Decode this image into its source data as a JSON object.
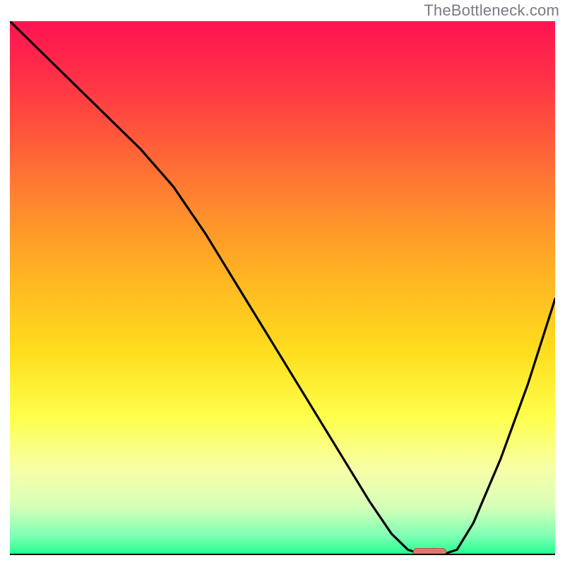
{
  "watermark": "TheBottleneck.com",
  "colors": {
    "gradient_stops": [
      {
        "offset": 0.0,
        "color": "#ff1353"
      },
      {
        "offset": 0.1,
        "color": "#ff2f47"
      },
      {
        "offset": 0.22,
        "color": "#ff5a3a"
      },
      {
        "offset": 0.35,
        "color": "#ff8a2e"
      },
      {
        "offset": 0.48,
        "color": "#ffb522"
      },
      {
        "offset": 0.62,
        "color": "#ffde1e"
      },
      {
        "offset": 0.74,
        "color": "#feff4a"
      },
      {
        "offset": 0.84,
        "color": "#f7ffa8"
      },
      {
        "offset": 0.91,
        "color": "#d6ffb8"
      },
      {
        "offset": 0.965,
        "color": "#7cffb4"
      },
      {
        "offset": 1.0,
        "color": "#1dff8c"
      }
    ],
    "curve": "#000000",
    "marker_fill": "#e0776f",
    "marker_stroke": "#b7554f"
  },
  "chart_data": {
    "type": "line",
    "title": "",
    "xlabel": "",
    "ylabel": "",
    "xlim": [
      0,
      100
    ],
    "ylim": [
      0,
      100
    ],
    "series": [
      {
        "name": "bottleneck-curve",
        "x": [
          0,
          6,
          12,
          18,
          24,
          30,
          36,
          42,
          48,
          54,
          60,
          66,
          70,
          73,
          76,
          79,
          82,
          85,
          90,
          95,
          100
        ],
        "y": [
          100,
          94,
          88,
          82,
          76,
          69,
          60,
          50,
          40,
          30,
          20,
          10,
          4,
          1,
          0,
          0,
          1,
          6,
          18,
          32,
          48
        ]
      }
    ],
    "marker": {
      "name": "optimal-range",
      "x_start": 74,
      "x_end": 80,
      "y": 0.6
    },
    "gradient_meaning": "vertical bottleneck severity (top=red=high, bottom=green=low)"
  }
}
